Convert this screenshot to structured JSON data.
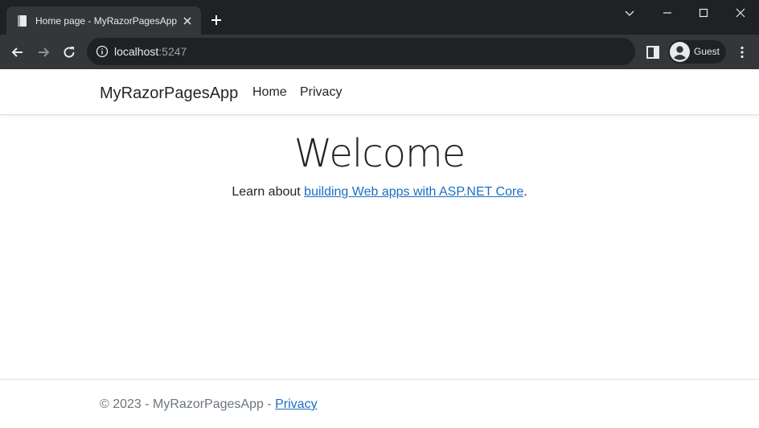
{
  "browser": {
    "tab_title": "Home page - MyRazorPagesApp",
    "url_host": "localhost",
    "url_port": ":5247",
    "profile_name": "Guest",
    "colors": {
      "frame": "#202124",
      "toolbar": "#35363a",
      "text": "#e8eaed"
    }
  },
  "site": {
    "brand": "MyRazorPagesApp",
    "nav": {
      "home": "Home",
      "privacy": "Privacy"
    },
    "heading": "Welcome",
    "intro_prefix": "Learn about ",
    "intro_link": "building Web apps with ASP.NET Core",
    "intro_suffix": ".",
    "footer_text": "© 2023 - MyRazorPagesApp - ",
    "footer_link": "Privacy",
    "colors": {
      "link": "#1b6ec2",
      "text": "#212529",
      "muted": "#6c757d"
    }
  }
}
